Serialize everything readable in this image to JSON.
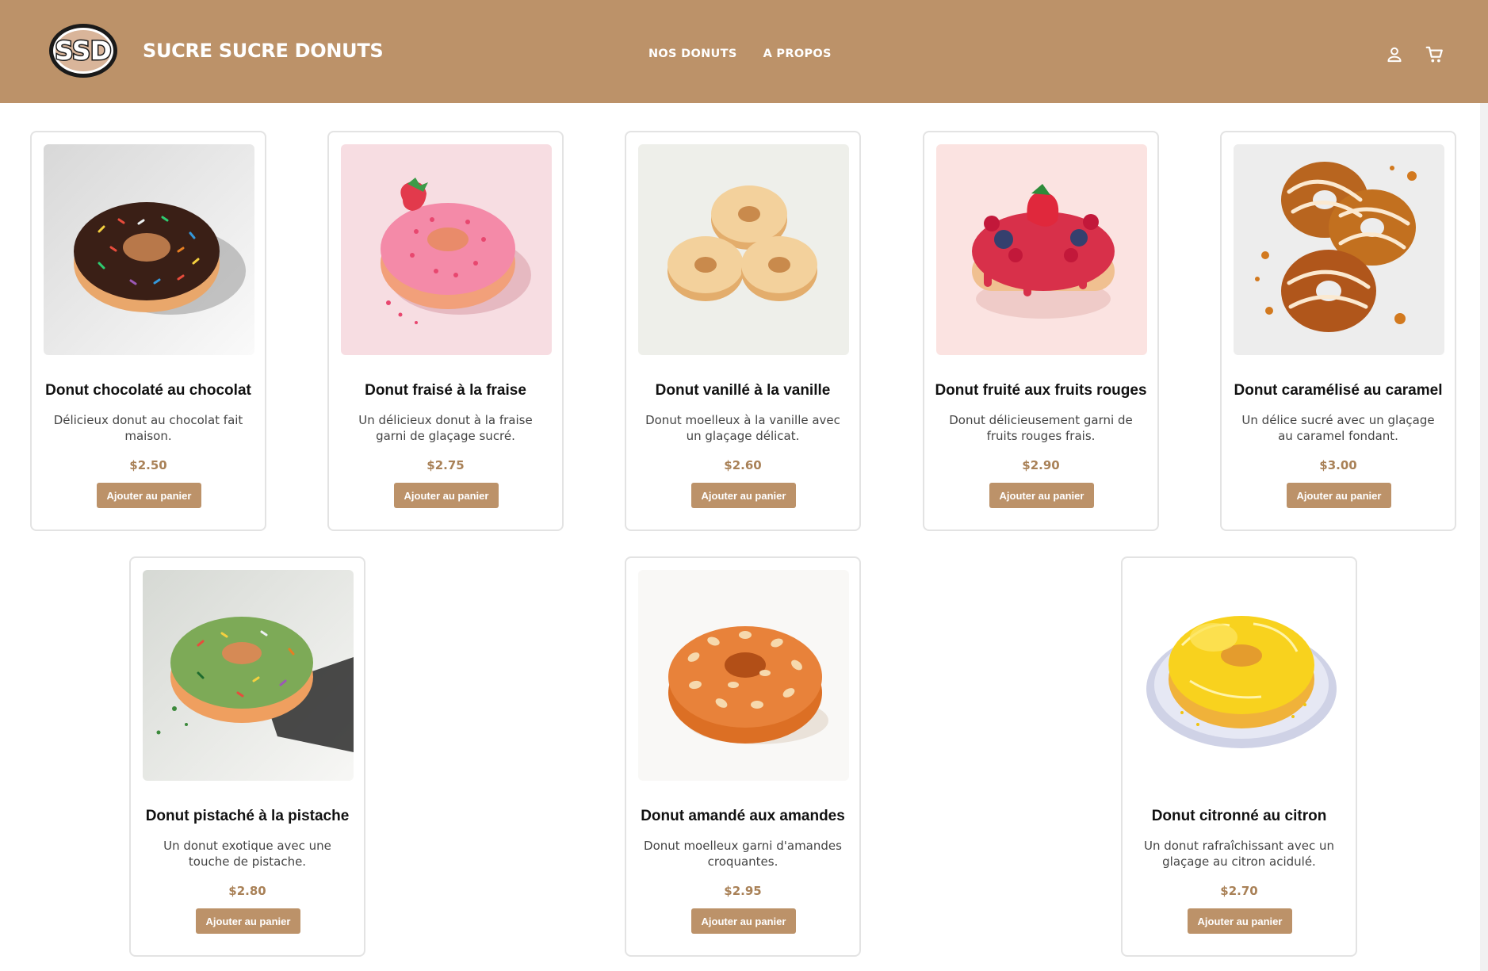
{
  "header": {
    "logo_text": "SSD",
    "brand": "SUCRE SUCRE DONUTS",
    "nav": [
      {
        "label": "NOS DONUTS"
      },
      {
        "label": "A PROPOS"
      }
    ],
    "icons": [
      "user-icon",
      "cart-icon"
    ]
  },
  "colors": {
    "header_bg": "#bc9269",
    "button_bg": "#bc9269",
    "price": "#a98157"
  },
  "products": [
    {
      "name": "Donut chocolaté au chocolat",
      "description": "Délicieux donut au chocolat fait maison.",
      "price": "$2.50",
      "button": "Ajouter au panier",
      "image": "chocolate-donut-image"
    },
    {
      "name": "Donut fraisé à la fraise",
      "description": "Un délicieux donut à la fraise garni de glaçage sucré.",
      "price": "$2.75",
      "button": "Ajouter au panier",
      "image": "strawberry-donut-image"
    },
    {
      "name": "Donut vanillé à la vanille",
      "description": "Donut moelleux à la vanille avec un glaçage délicat.",
      "price": "$2.60",
      "button": "Ajouter au panier",
      "image": "vanilla-donuts-image"
    },
    {
      "name": "Donut fruité aux fruits rouges",
      "description": "Donut délicieusement garni de fruits rouges frais.",
      "price": "$2.90",
      "button": "Ajouter au panier",
      "image": "red-fruits-donut-image"
    },
    {
      "name": "Donut caramélisé au caramel",
      "description": "Un délice sucré avec un glaçage au caramel fondant.",
      "price": "$3.00",
      "button": "Ajouter au panier",
      "image": "caramel-donuts-image"
    },
    {
      "name": "Donut pistaché à la pistache",
      "description": "Un donut exotique avec une touche de pistache.",
      "price": "$2.80",
      "button": "Ajouter au panier",
      "image": "pistachio-donut-image"
    },
    {
      "name": "Donut amandé aux amandes",
      "description": "Donut moelleux garni d'amandes croquantes.",
      "price": "$2.95",
      "button": "Ajouter au panier",
      "image": "almond-donut-image"
    },
    {
      "name": "Donut citronné au citron",
      "description": "Un donut rafraîchissant avec un glaçage au citron acidulé.",
      "price": "$2.70",
      "button": "Ajouter au panier",
      "image": "lemon-donut-image"
    }
  ]
}
